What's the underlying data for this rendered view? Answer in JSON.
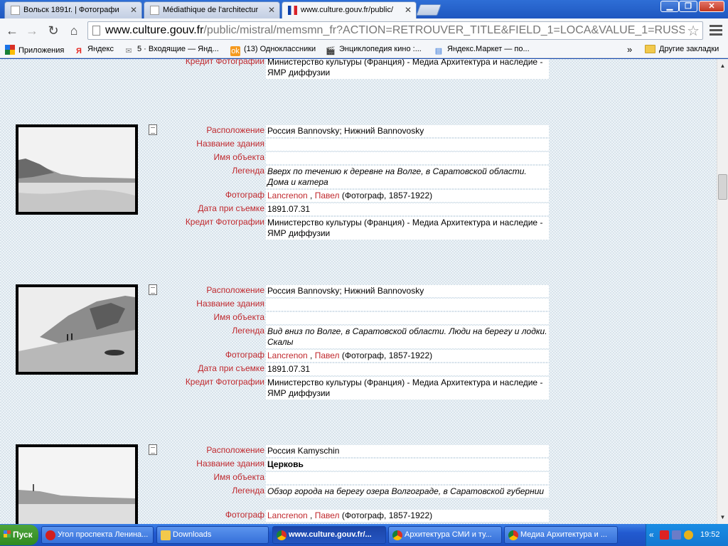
{
  "tabs": [
    {
      "label": "Вольск 1891г. | Фотографи",
      "active": false
    },
    {
      "label": "Médiathique de l'architectur",
      "active": false
    },
    {
      "label": "www.culture.gouv.fr/public/",
      "active": true
    }
  ],
  "address": {
    "host": "www.culture.gouv.fr",
    "path": "/public/mistral/memsmn_fr?ACTION=RETROUVER_TITLE&FIELD_1=LOCA&VALUE_1=RUSS"
  },
  "bookmarks": {
    "items": [
      "Приложения",
      "Яндекс",
      "5 · Входящие — Янд...",
      "(13) Одноклассники",
      "Энциклопедия кино :...",
      "Яндекс.Маркет — по..."
    ],
    "overflow": "»",
    "other": "Другие закладки"
  },
  "partial_record": {
    "label": "Кредит Фотографии",
    "value": "Министерство культуры (Франция) - Медиа Архитектура и наследие - ЯМР диффузии"
  },
  "records": [
    {
      "location_label": "Расположение",
      "location": "Россия Bannovsky; Нижний Bannovosky",
      "building_label": "Название здания",
      "building": "",
      "object_label": "Имя объекта",
      "object": "",
      "legend_label": "Легенда",
      "legend": "Вверх по течению к деревне на Волге, в Саратовской области. Дома и катера",
      "photographer_label": "Фотограф",
      "ph_surname": "Lancrenon",
      "ph_sep": " , ",
      "ph_name": "Павел",
      "ph_rest": " (Фотограф, 1857-1922)",
      "date_label": "Дата при съемке",
      "date": "1891.07.31",
      "credit_label": "Кредит Фотографии",
      "credit": "Министерство культуры (Франция) - Медиа Архитектура и наследие - ЯМР диффузии"
    },
    {
      "location_label": "Расположение",
      "location": "Россия Bannovsky; Нижний Bannovosky",
      "building_label": "Название здания",
      "building": "",
      "object_label": "Имя объекта",
      "object": "",
      "legend_label": "Легенда",
      "legend": "Вид вниз по Волге, в Саратовской области. Люди на берегу и лодки. Скалы",
      "photographer_label": "Фотограф",
      "ph_surname": "Lancrenon",
      "ph_sep": " , ",
      "ph_name": "Павел",
      "ph_rest": " (Фотограф, 1857-1922)",
      "date_label": "Дата при съемке",
      "date": "1891.07.31",
      "credit_label": "Кредит Фотографии",
      "credit": "Министерство культуры (Франция) - Медиа Архитектура и наследие - ЯМР диффузии"
    },
    {
      "location_label": "Расположение",
      "location": "Россия Kamyschin",
      "building_label": "Название здания",
      "building": "Церковь",
      "object_label": "Имя объекта",
      "object": "",
      "legend_label": "Легенда",
      "legend": "Обзор города на берегу озера Волгограде, в Саратовской губернии",
      "photographer_label": "Фотограф",
      "ph_surname": "Lancrenon",
      "ph_sep": " , ",
      "ph_name": "Павел",
      "ph_rest": " (Фотограф, 1857-1922)"
    }
  ],
  "taskbar": {
    "start": "Пуск",
    "tasks": [
      "Угол проспекта Ленина...",
      "Downloads",
      "www.culture.gouv.fr/...",
      "Архитектура СМИ и ту...",
      "Медиа Архитектура и ..."
    ],
    "tray_chevron": "«",
    "clock": "19:52"
  }
}
